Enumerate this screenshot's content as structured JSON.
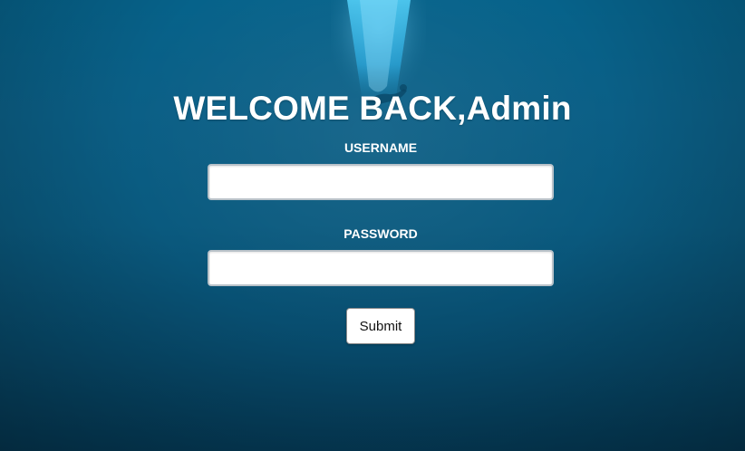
{
  "page": {
    "title": "WELCOME BACK,Admin"
  },
  "form": {
    "username_label": "USERNAME",
    "username_value": "",
    "password_label": "PASSWORD",
    "password_value": "",
    "submit_label": "Submit"
  },
  "colors": {
    "background_top": "#06628a",
    "background_bottom": "#053a56",
    "text": "#ffffff",
    "input_background": "#ffffff",
    "input_border": "#b9c2c9",
    "button_border": "#8d8d8d"
  },
  "background": {
    "image_subject": "underwater-diver"
  }
}
